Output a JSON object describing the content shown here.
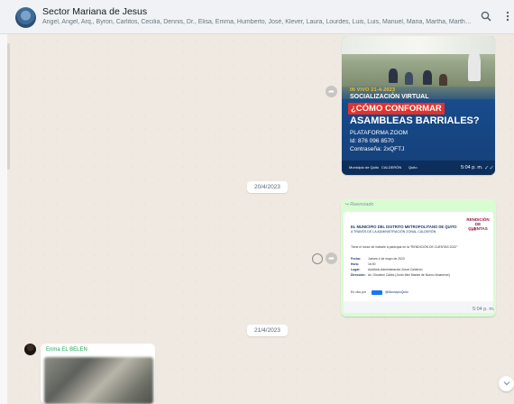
{
  "header": {
    "title": "Sector Mariana de Jesus",
    "members": "Angel, Angel, Arq., Byron, Carlitos, Cecilia, Dennis, Dr., Elisa, Emma, Humberto, José, Klever, Laura, Lourdes, Luis, Luis, Manuel, Maria, Martha, Martha, Milton, Ric...",
    "search_icon": "search-icon",
    "menu_icon": "kebab-menu-icon"
  },
  "messages": {
    "poster": {
      "tag": "IN VIVO 21-4-2023",
      "line1": "SOCIALIZACIÓN VIRTUAL",
      "line2": "¿CÓMO CONFORMAR",
      "line3": "ASAMBLEAS BARRIALES?",
      "platform": "PLATAFORMA ZOOM",
      "meeting_id": "Id: 876 096 8570",
      "password": "Contraseña: 2xQFTJ",
      "logo1": "Municipio de Quito",
      "logo2": "CALDERÓN",
      "logo3": "Quito",
      "time": "5:04 p. m.",
      "ticks": "✓✓"
    },
    "date1": "20/4/2023",
    "forwarded": {
      "label": "Reenviado",
      "header1": "EL MUNICIPIO DEL DISTRITO METROPOLITANO DE QUITO",
      "header2": "A TRAVÉS DE LA ADMINISTRACIÓN ZONAL CALDERÓN",
      "rend_title": "RENDICIÓN DE CUENTAS",
      "rend_year": "2022",
      "invite": "Tiene el honor de invitarle a participar en la \"RENDICIÓN DE CUENTAS 2022\"",
      "rows": [
        {
          "k": "Fecha:",
          "v": "Jueves 4 de mayo de 2023"
        },
        {
          "k": "Hora:",
          "v": "16:00"
        },
        {
          "k": "Lugar:",
          "v": "Auditorio Administración Zonal Calderón"
        },
        {
          "k": "Dirección:",
          "v": "Av. Giovanni Calles (Junto Mini Market de Nuevo Amanecer)"
        }
      ],
      "live": "@MunicipioQuito",
      "live_prefix": "En vivo por",
      "time": "5:04 p. m."
    },
    "date2": "21/4/2023",
    "incoming": {
      "sender": "Enma EL BELEN"
    }
  }
}
